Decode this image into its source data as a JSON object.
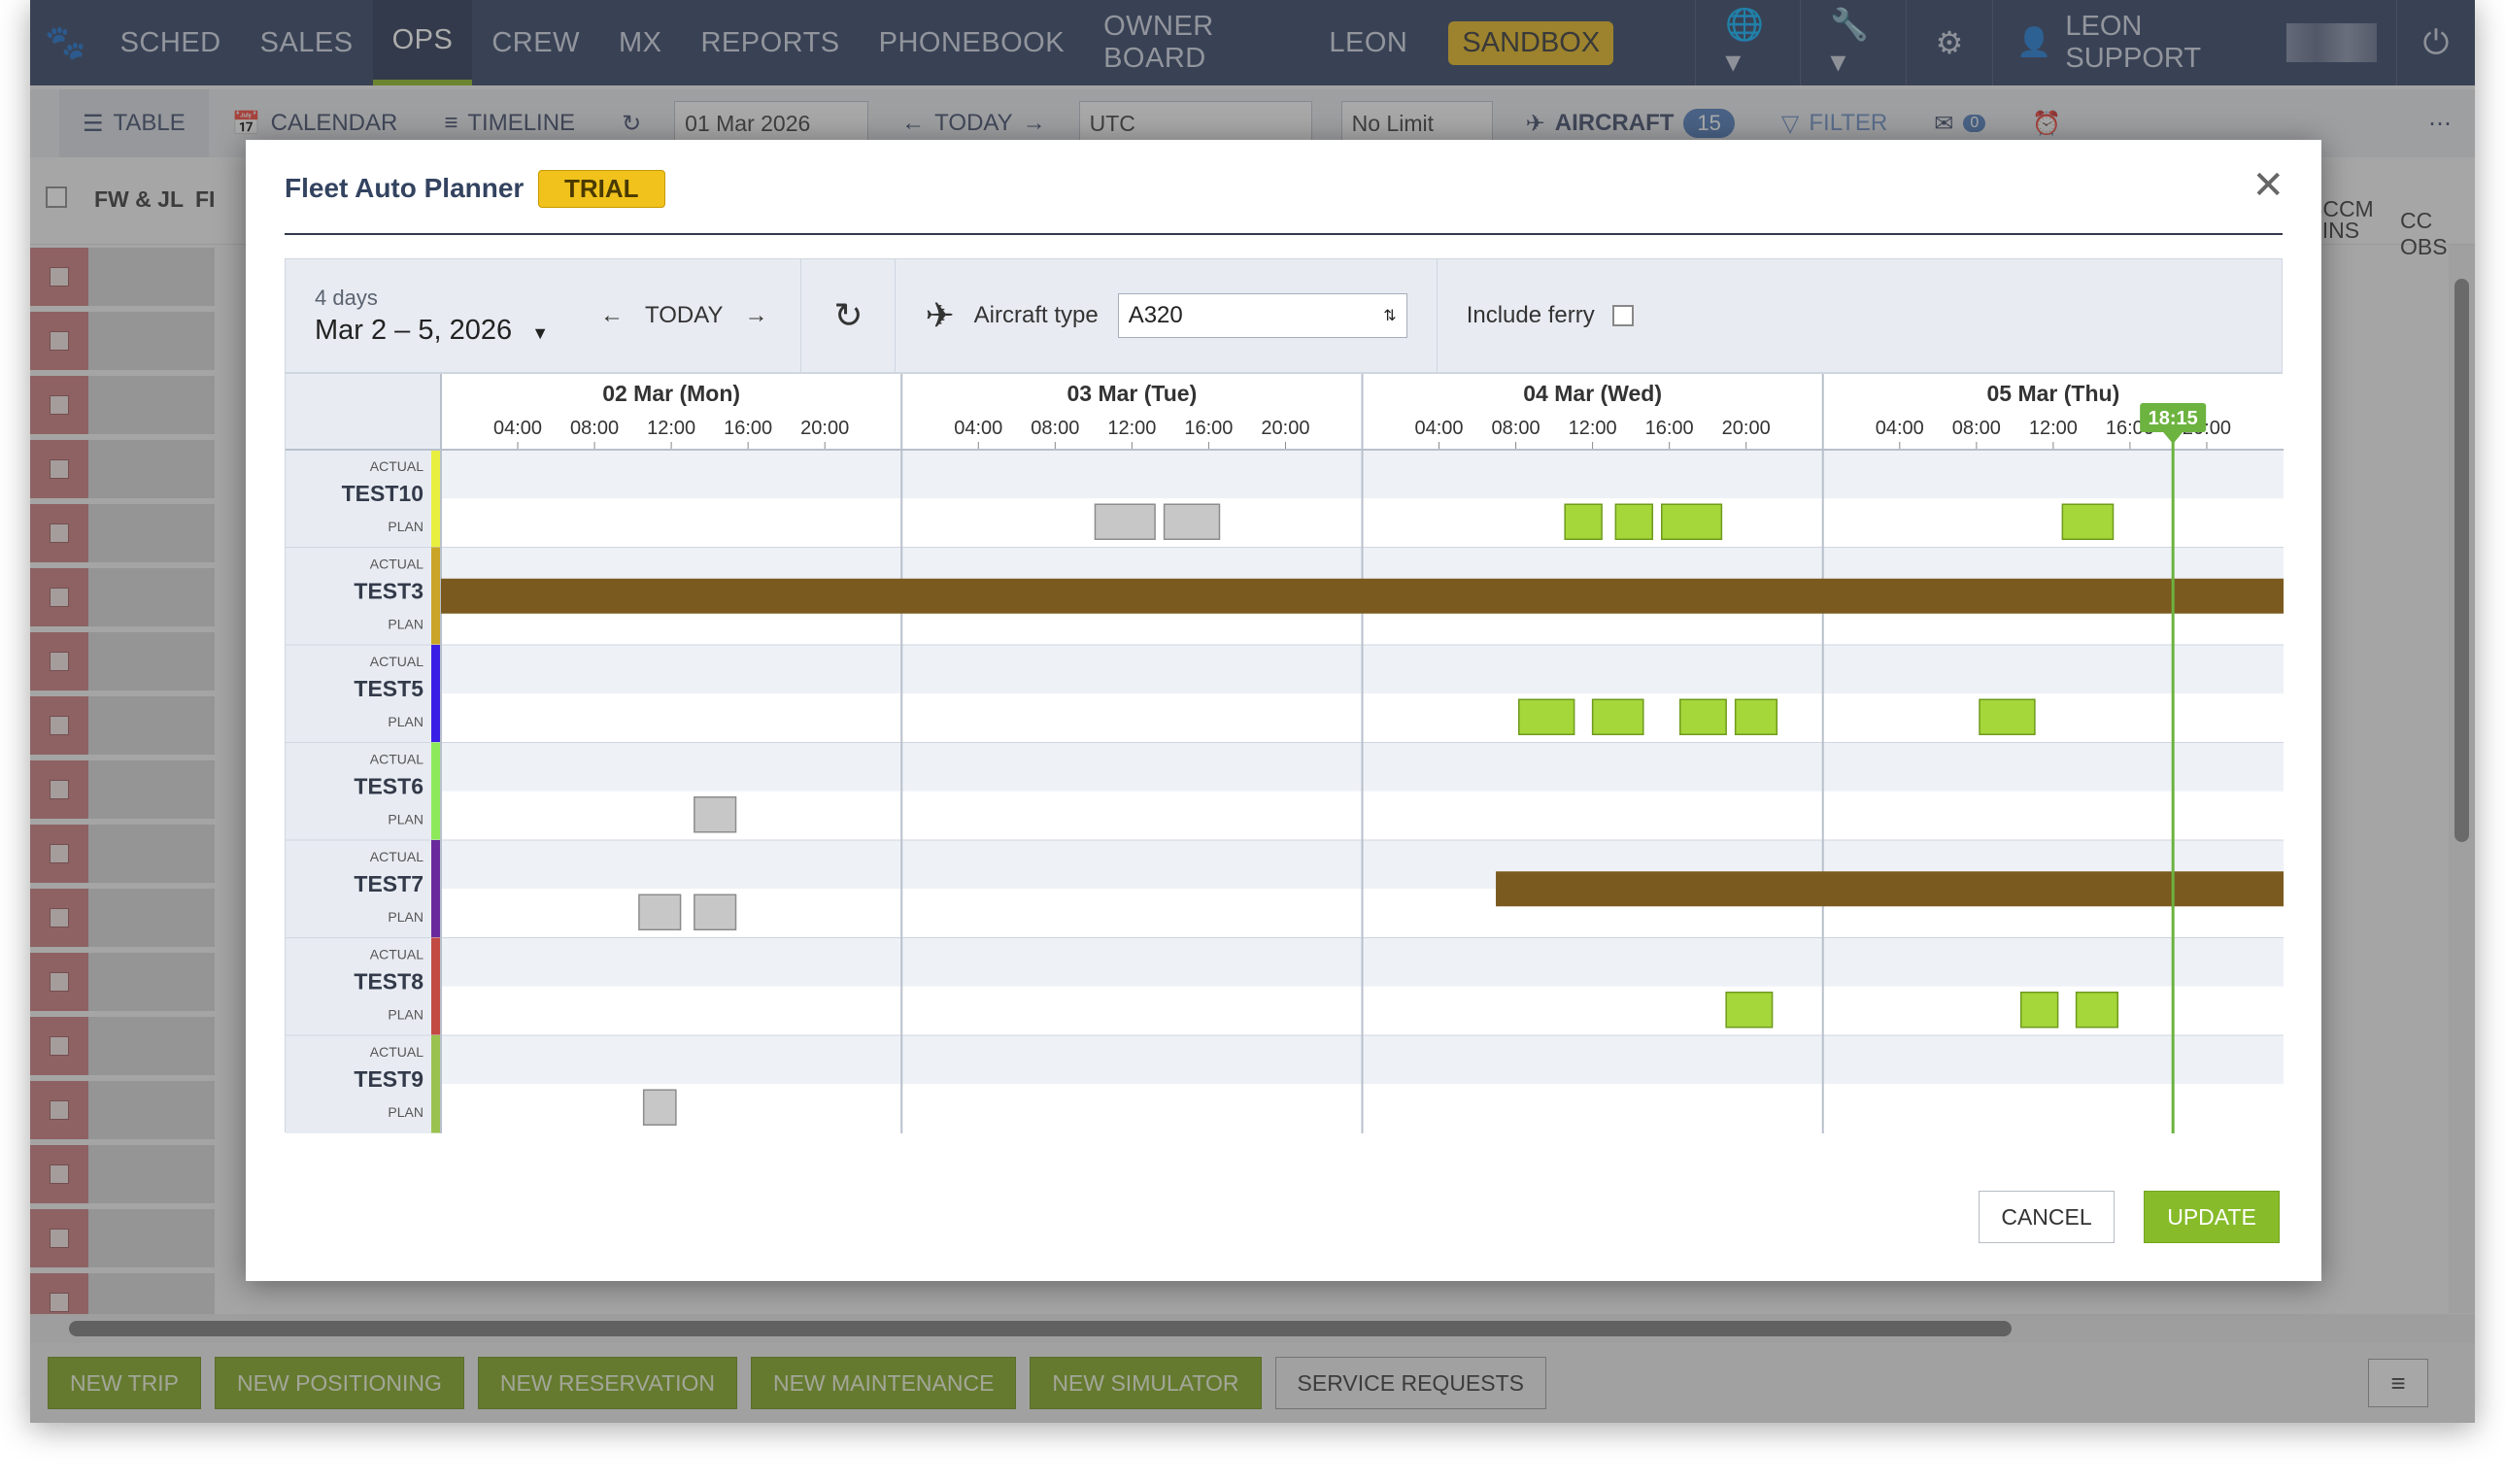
{
  "nav": {
    "items": [
      "SCHED",
      "SALES",
      "OPS",
      "CREW",
      "MX",
      "REPORTS",
      "PHONEBOOK",
      "OWNER BOARD",
      "LEON"
    ],
    "active": "OPS",
    "sandbox": "SANDBOX",
    "user": "LEON SUPPORT"
  },
  "toolbar": {
    "table": "TABLE",
    "calendar": "CALENDAR",
    "timeline": "TIMELINE",
    "date": "01 Mar 2026",
    "today": "TODAY",
    "timezone": "UTC",
    "limit": "No Limit",
    "aircraft": "AIRCRAFT",
    "aircraft_count": "15",
    "filter": "FILTER",
    "messages": "0"
  },
  "table_head": {
    "col1": "FW & JL",
    "col2": "FI",
    "col_sccm_1": "SCCM",
    "col_sccm_2": "INS",
    "col_cc": "CC OBS"
  },
  "footer": {
    "new_trip": "NEW TRIP",
    "new_positioning": "NEW POSITIONING",
    "new_reservation": "NEW RESERVATION",
    "new_maintenance": "NEW MAINTENANCE",
    "new_simulator": "NEW SIMULATOR",
    "service_requests": "SERVICE REQUESTS"
  },
  "modal": {
    "title": "Fleet Auto Planner",
    "badge": "TRIAL",
    "range_small": "4 days",
    "range_big": "Mar 2 – 5, 2026",
    "today": "TODAY",
    "aircraft_type_label": "Aircraft type",
    "aircraft_type_value": "A320",
    "include_ferry": "Include ferry",
    "cancel": "CANCEL",
    "update": "UPDATE",
    "now_label": "18:15",
    "days": [
      "02 Mar (Mon)",
      "03 Mar (Tue)",
      "04 Mar (Wed)",
      "05 Mar (Thu)"
    ],
    "hour_ticks": [
      "04:00",
      "08:00",
      "12:00",
      "16:00",
      "20:00"
    ],
    "actual_label": "ACTUAL",
    "plan_label": "PLAN",
    "colors": {
      "trip_green": "#a5d63a",
      "maint_brown": "#7a5a1f",
      "pending_grey": "#c7c7c7",
      "now_line": "#6cb33f"
    },
    "aircraft": [
      {
        "reg": "TEST10",
        "color": "#e8ef3f",
        "plan": [
          {
            "s": 1.42,
            "e": 1.55,
            "k": "grey"
          },
          {
            "s": 1.57,
            "e": 1.69,
            "k": "grey"
          },
          {
            "s": 2.44,
            "e": 2.52,
            "k": "green"
          },
          {
            "s": 2.55,
            "e": 2.63,
            "k": "green"
          },
          {
            "s": 2.65,
            "e": 2.78,
            "k": "green"
          },
          {
            "s": 3.52,
            "e": 3.63,
            "k": "green"
          }
        ],
        "actual": []
      },
      {
        "reg": "TEST3",
        "color": "#c8a526",
        "plan": [],
        "actual": [],
        "block": {
          "s": 0.0,
          "e": 4.0
        }
      },
      {
        "reg": "TEST5",
        "color": "#3a1ee6",
        "plan": [
          {
            "s": 2.34,
            "e": 2.46,
            "k": "green"
          },
          {
            "s": 2.5,
            "e": 2.61,
            "k": "green"
          },
          {
            "s": 2.69,
            "e": 2.79,
            "k": "green"
          },
          {
            "s": 2.81,
            "e": 2.9,
            "k": "green"
          },
          {
            "s": 3.34,
            "e": 3.46,
            "k": "green"
          }
        ],
        "actual": []
      },
      {
        "reg": "TEST6",
        "color": "#8de85a",
        "plan": [
          {
            "s": 0.55,
            "e": 0.64,
            "k": "grey"
          }
        ],
        "actual": []
      },
      {
        "reg": "TEST7",
        "color": "#6a2a9c",
        "plan": [
          {
            "s": 0.43,
            "e": 0.52,
            "k": "grey"
          },
          {
            "s": 0.55,
            "e": 0.64,
            "k": "grey"
          }
        ],
        "actual": [],
        "block": {
          "s": 2.29,
          "e": 4.0
        }
      },
      {
        "reg": "TEST8",
        "color": "#c24a43",
        "plan": [
          {
            "s": 2.79,
            "e": 2.89,
            "k": "green"
          },
          {
            "s": 3.43,
            "e": 3.51,
            "k": "green"
          },
          {
            "s": 3.55,
            "e": 3.64,
            "k": "green"
          }
        ],
        "actual": []
      },
      {
        "reg": "TEST9",
        "color": "#9ac24e",
        "plan": [
          {
            "s": 0.44,
            "e": 0.51,
            "k": "grey"
          }
        ],
        "actual": []
      }
    ],
    "now_pos": 3.76
  }
}
